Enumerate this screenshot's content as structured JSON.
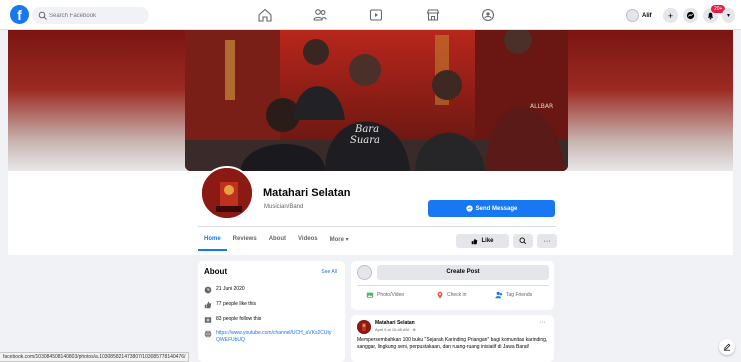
{
  "topbar": {
    "logo": "f",
    "search_placeholder": "Search Facebook",
    "nav_icons": [
      "home-icon",
      "friends-icon",
      "watch-icon",
      "marketplace-icon",
      "groups-icon"
    ],
    "profile_name": "Alif",
    "notif_badge": "20+"
  },
  "page": {
    "name": "Matahari Selatan",
    "category": "Musician/Band",
    "send_message_label": "Send Message",
    "like_label": "Like"
  },
  "tabs": [
    "Home",
    "Reviews",
    "About",
    "Videos",
    "More ▾"
  ],
  "about": {
    "title": "About",
    "see_all": "See All",
    "rows": [
      {
        "icon": "clock-icon",
        "text": "21 Juni 2020"
      },
      {
        "icon": "thumbs-up-icon",
        "text": "77 people like this"
      },
      {
        "icon": "follow-icon",
        "text": "83 people follow this"
      },
      {
        "icon": "globe-icon",
        "text": "https://www.youtube.com/channel/UCH_aVKs2CUtyQWEFUbUQ"
      }
    ]
  },
  "create_post": {
    "label": "Create Post",
    "actions": [
      {
        "icon": "photo-icon",
        "label": "Photo/Video",
        "color": "#45bd62"
      },
      {
        "icon": "check-in-icon",
        "label": "Check in",
        "color": "#f5533d"
      },
      {
        "icon": "tag-friends-icon",
        "label": "Tag Friends",
        "color": "#1877f2"
      }
    ]
  },
  "post": {
    "author": "Matahari Selatan",
    "time": "April 9 at 10:48 AM · ⊕",
    "text": "Mempersembahkan 100 buku \"Sejarah Karinding Priangan\" bagi komunitas karinding, sanggar, lingkung seni, perpustakaan, dan ruang-ruang inisiatif di Jawa Barat!"
  },
  "status_url": "facebook.com/103084508140803/photos/a.103085821473807/103085778140476/",
  "colors": {
    "accent": "#1877f2",
    "badge": "#e41e3f",
    "cover": "#8c1a14"
  }
}
